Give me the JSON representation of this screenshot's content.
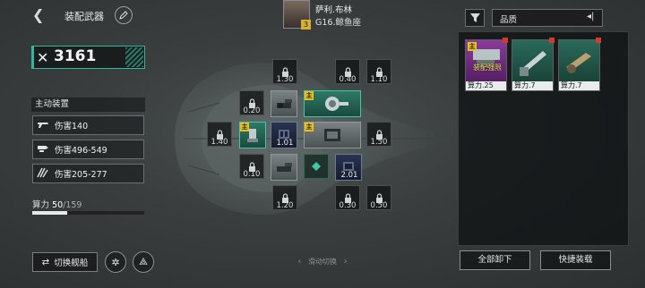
{
  "header": {
    "title": "装配武器",
    "pilot": {
      "name": "萨利.布林",
      "ship": "G16.鲸鱼座",
      "level": "3"
    }
  },
  "power": {
    "value": "3161"
  },
  "active_equipment": {
    "label": "主动装置",
    "stats": [
      {
        "icon": "gun-icon",
        "text": "伤害140"
      },
      {
        "icon": "missile-icon",
        "text": "伤害496-549"
      },
      {
        "icon": "laser-icon",
        "text": "伤害205-277"
      }
    ]
  },
  "compute": {
    "label": "算力",
    "current": "50",
    "separator": "/",
    "max": "159",
    "fraction": 0.314
  },
  "bottom": {
    "switch_ship": "切换舰船",
    "slide_switch": "滑动切换"
  },
  "slots": {
    "locked": [
      "1.30",
      "0.40",
      "1.10",
      "0.20",
      "1.40",
      "1.50",
      "0.10",
      "1.20",
      "0.30",
      "0.50"
    ],
    "equipped": [
      "1.01",
      "2.01"
    ],
    "main_tag": "主"
  },
  "right_panel": {
    "sort_label": "品质",
    "cards": [
      {
        "power": "算力.25",
        "label": "装配强限"
      },
      {
        "power": "算力.7"
      },
      {
        "power": "算力.7"
      }
    ],
    "unload_all": "全部卸下",
    "quick_equip": "快捷装载"
  },
  "colors": {
    "accent": "#2fb89c",
    "tag": "#e8c020",
    "badge": "#d83a2a"
  }
}
